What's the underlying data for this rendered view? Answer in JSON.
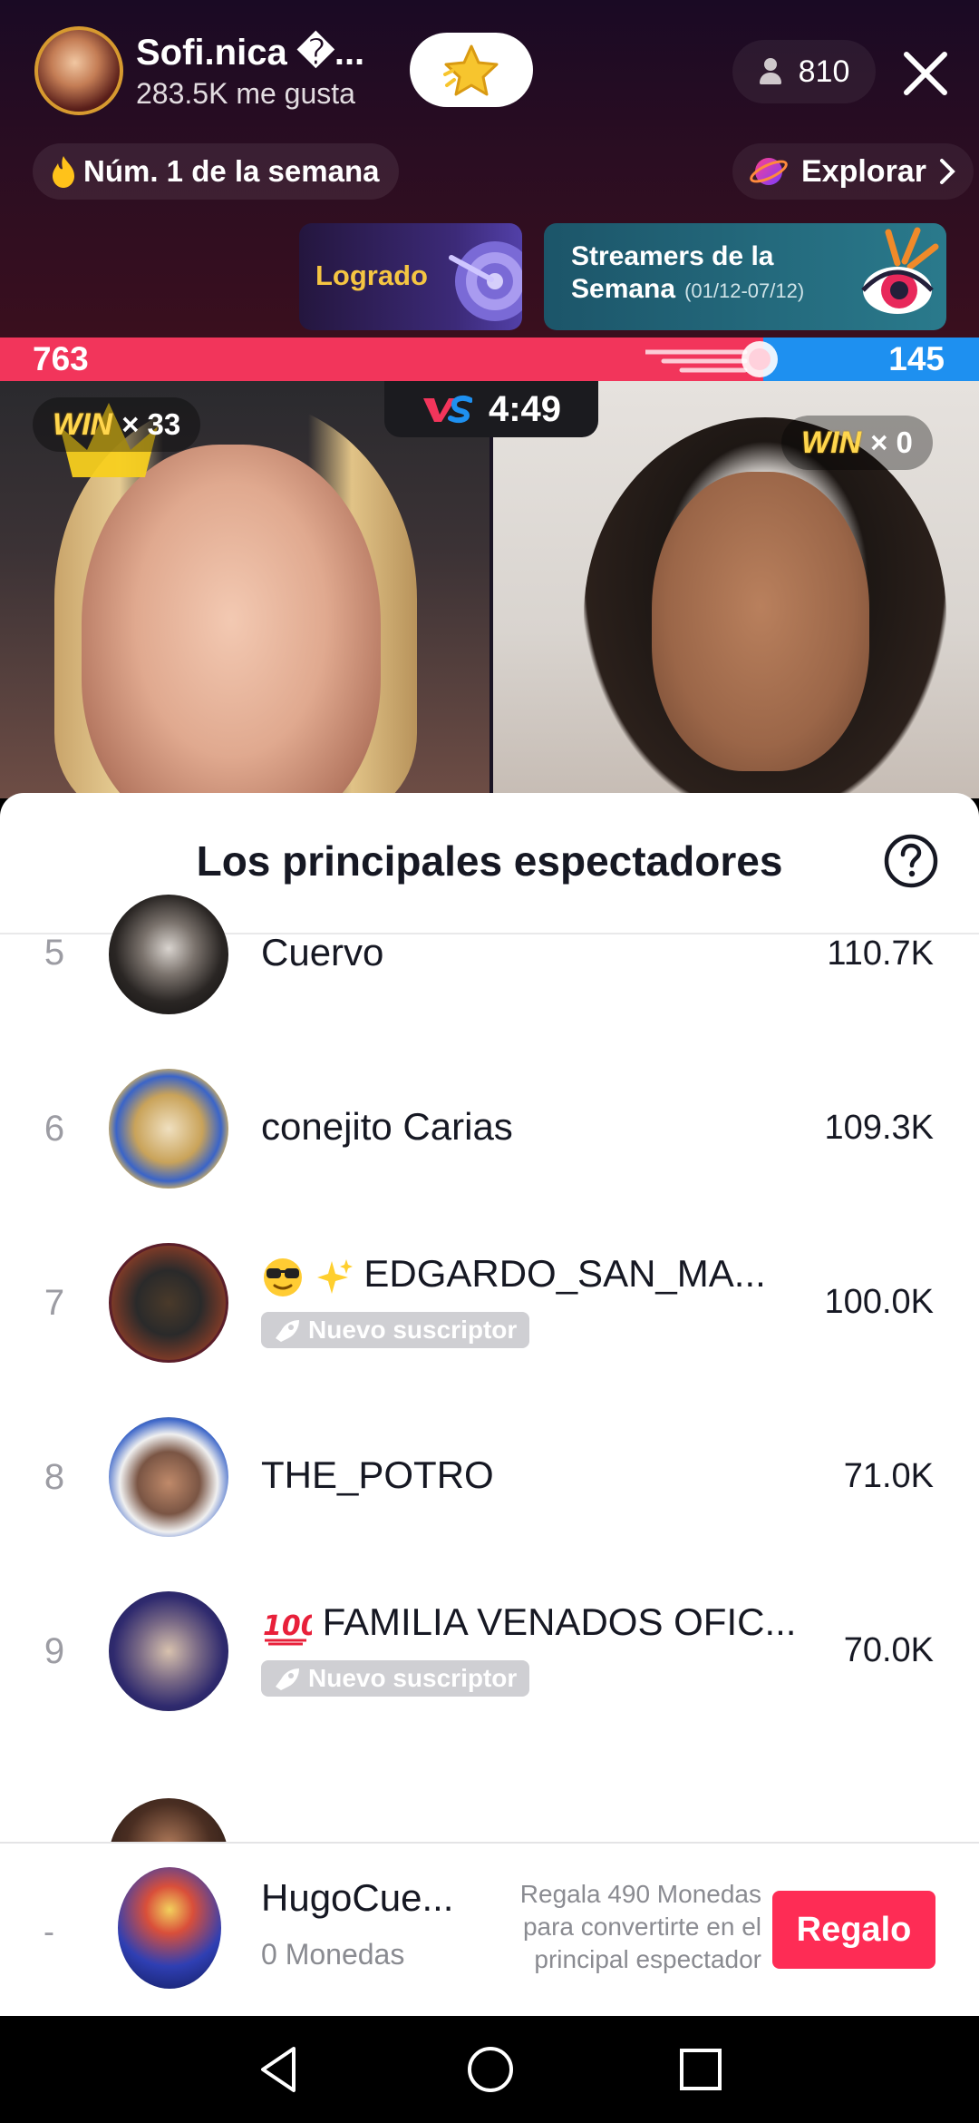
{
  "host": {
    "name": "Sofi.nica �...",
    "likes": "283.5K me gusta",
    "viewers": "810"
  },
  "badges": {
    "rank": "Núm. 1 de la semana",
    "explore": "Explorar",
    "achieved": "Logrado",
    "streamers_line1": "Streamers de la",
    "streamers_line2": "Semana",
    "streamers_dates": "(01/12-07/12)"
  },
  "battle": {
    "score_left": "763",
    "score_right": "145",
    "score_left_share": 0.78,
    "timer": "4:49",
    "win_word": "WIN",
    "left_wins": "× 33",
    "right_wins": "× 0"
  },
  "sheet": {
    "title": "Los principales espectadores",
    "rows": [
      {
        "rank": "5",
        "name": "Cuervo",
        "score": "110.7K",
        "badge": ""
      },
      {
        "rank": "6",
        "name": "conejito Carias",
        "score": "109.3K",
        "badge": ""
      },
      {
        "rank": "7",
        "name": "EDGARDO_SAN_MA...",
        "score": "100.0K",
        "badge": "Nuevo suscriptor"
      },
      {
        "rank": "8",
        "name": "THE_POTRO",
        "score": "71.0K",
        "badge": ""
      },
      {
        "rank": "9",
        "name": "FAMILIA VENADOS OFIC...",
        "score": "70.0K",
        "badge": "Nuevo suscriptor"
      }
    ]
  },
  "self": {
    "rank": "-",
    "name": "HugoCue...",
    "coins": "0 Monedas",
    "hint": "Regala 490 Monedas para convertirte en el principal espectador",
    "gift_label": "Regalo"
  },
  "colors": {
    "accent": "#fe2c55",
    "score_red": "#f2355b",
    "score_blue": "#1e90f0"
  }
}
